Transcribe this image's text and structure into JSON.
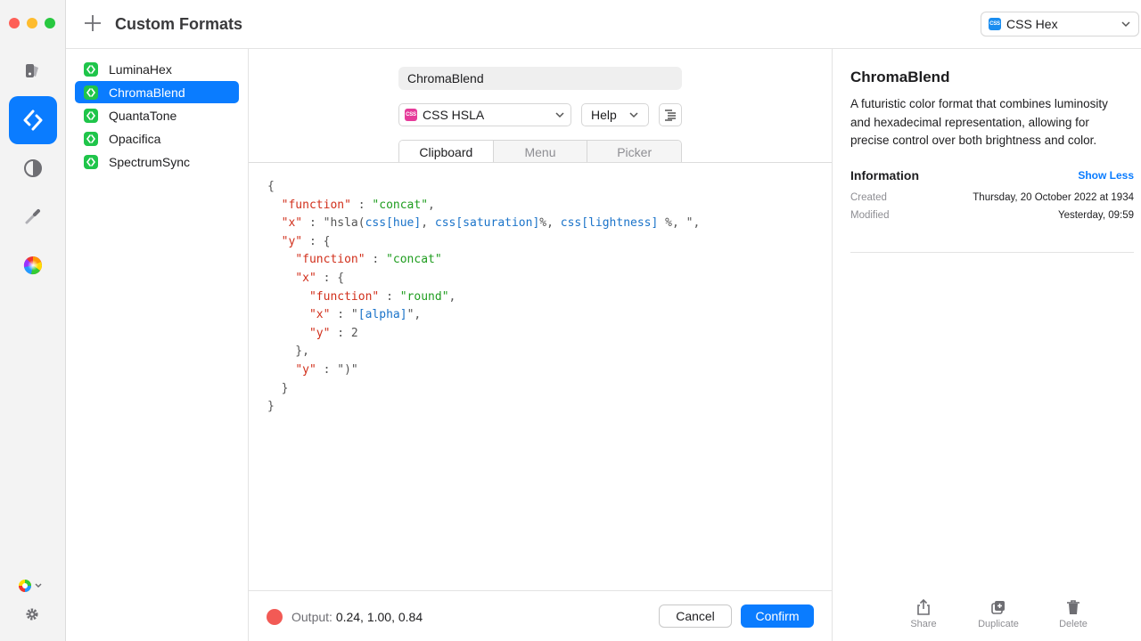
{
  "header": {
    "title": "Custom Formats",
    "format_select": {
      "badge": "CSS",
      "label": "CSS Hex"
    }
  },
  "formats": [
    {
      "name": "LuminaHex",
      "selected": false
    },
    {
      "name": "ChromaBlend",
      "selected": true
    },
    {
      "name": "QuantaTone",
      "selected": false
    },
    {
      "name": "Opacifica",
      "selected": false
    },
    {
      "name": "SpectrumSync",
      "selected": false
    }
  ],
  "editor": {
    "name_value": "ChromaBlend",
    "type_select": {
      "badge": "CSS",
      "label": "CSS HSLA"
    },
    "help_label": "Help",
    "tabs": [
      {
        "label": "Clipboard",
        "active": true
      },
      {
        "label": "Menu",
        "active": false
      },
      {
        "label": "Picker",
        "active": false
      }
    ],
    "code": [
      [
        [
          "p",
          "{"
        ]
      ],
      [
        [
          "p",
          "  "
        ],
        [
          "k",
          "\"function\""
        ],
        [
          "p",
          " : "
        ],
        [
          "s",
          "\"concat\""
        ],
        [
          "p",
          ","
        ]
      ],
      [
        [
          "p",
          "  "
        ],
        [
          "k",
          "\"x\""
        ],
        [
          "p",
          " : \"hsla("
        ],
        [
          "v",
          "css[hue]"
        ],
        [
          "p",
          ", "
        ],
        [
          "v",
          "css[saturation]"
        ],
        [
          "p",
          "%, "
        ],
        [
          "v",
          "css[lightness]"
        ],
        [
          "p",
          " %, \","
        ]
      ],
      [
        [
          "p",
          "  "
        ],
        [
          "k",
          "\"y\""
        ],
        [
          "p",
          " : {"
        ]
      ],
      [
        [
          "p",
          "    "
        ],
        [
          "k",
          "\"function\""
        ],
        [
          "p",
          " : "
        ],
        [
          "s",
          "\"concat\""
        ]
      ],
      [
        [
          "p",
          "    "
        ],
        [
          "k",
          "\"x\""
        ],
        [
          "p",
          " : {"
        ]
      ],
      [
        [
          "p",
          "      "
        ],
        [
          "k",
          "\"function\""
        ],
        [
          "p",
          " : "
        ],
        [
          "s",
          "\"round\""
        ],
        [
          "p",
          ","
        ]
      ],
      [
        [
          "p",
          "      "
        ],
        [
          "k",
          "\"x\""
        ],
        [
          "p",
          " : \""
        ],
        [
          "v",
          "[alpha]"
        ],
        [
          "p",
          "\","
        ]
      ],
      [
        [
          "p",
          "      "
        ],
        [
          "k",
          "\"y\""
        ],
        [
          "p",
          " : 2"
        ]
      ],
      [
        [
          "p",
          "    },"
        ]
      ],
      [
        [
          "p",
          "    "
        ],
        [
          "k",
          "\"y\""
        ],
        [
          "p",
          " : \")\""
        ]
      ],
      [
        [
          "p",
          "  }"
        ]
      ],
      [
        [
          "p",
          "}"
        ]
      ]
    ],
    "output_label": "Output: ",
    "output_value": "0.24, 1.00, 0.84",
    "output_color": "#f25a55",
    "cancel_label": "Cancel",
    "confirm_label": "Confirm"
  },
  "info": {
    "title": "ChromaBlend",
    "description": "A futuristic color format that combines luminosity and hexadecimal representation, allowing for precise control over both brightness and color.",
    "section_title": "Information",
    "toggle_label": "Show Less",
    "created_label": "Created",
    "created_value": "Thursday, 20 October 2022 at 1934",
    "modified_label": "Modified",
    "modified_value": "Yesterday, 09:59",
    "actions": [
      {
        "label": "Share",
        "icon": "share-icon"
      },
      {
        "label": "Duplicate",
        "icon": "duplicate-icon"
      },
      {
        "label": "Delete",
        "icon": "trash-icon"
      }
    ]
  },
  "colors": {
    "accent": "#0a7cff",
    "format_icon": "#1fc54a",
    "css_badge": "#1a8df0",
    "css_badge_hsla": "#e63b9a"
  }
}
